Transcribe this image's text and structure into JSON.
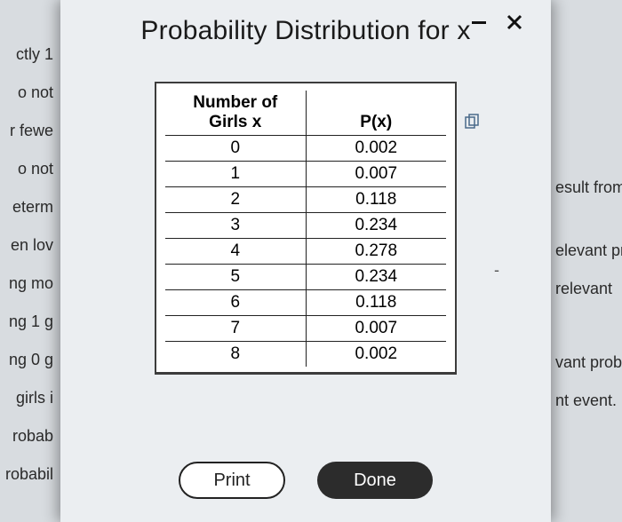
{
  "modal": {
    "title": "Probability Distribution for x",
    "table": {
      "col1_header_line1": "Number of",
      "col1_header_line2": "Girls x",
      "col2_header": "P(x)",
      "rows": [
        {
          "x": "0",
          "p": "0.002"
        },
        {
          "x": "1",
          "p": "0.007"
        },
        {
          "x": "2",
          "p": "0.118"
        },
        {
          "x": "3",
          "p": "0.234"
        },
        {
          "x": "4",
          "p": "0.278"
        },
        {
          "x": "5",
          "p": "0.234"
        },
        {
          "x": "6",
          "p": "0.118"
        },
        {
          "x": "7",
          "p": "0.007"
        },
        {
          "x": "8",
          "p": "0.002"
        }
      ]
    },
    "buttons": {
      "print": "Print",
      "done": "Done"
    }
  },
  "bg_left": [
    "ctly 1",
    "o not",
    "r fewe",
    "o not",
    "eterm",
    "en lov",
    "ng mo",
    "ng 1 g",
    "ng 0 g",
    "girls i",
    "robab",
    "robabil"
  ],
  "bg_right": [
    "esult from",
    "elevant pr",
    "relevant",
    "vant proba",
    "nt event."
  ],
  "chart_data": {
    "type": "table",
    "title": "Probability Distribution for x",
    "columns": [
      "Number of Girls x",
      "P(x)"
    ],
    "rows": [
      [
        0,
        0.002
      ],
      [
        1,
        0.007
      ],
      [
        2,
        0.118
      ],
      [
        3,
        0.234
      ],
      [
        4,
        0.278
      ],
      [
        5,
        0.234
      ],
      [
        6,
        0.118
      ],
      [
        7,
        0.007
      ],
      [
        8,
        0.002
      ]
    ]
  }
}
